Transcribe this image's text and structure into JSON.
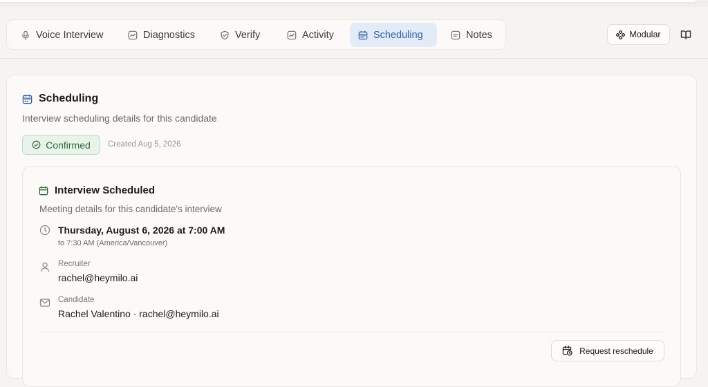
{
  "tabs": [
    {
      "label": "Voice Interview",
      "icon": "microphone-icon"
    },
    {
      "label": "Diagnostics",
      "icon": "chart-line-icon"
    },
    {
      "label": "Verify",
      "icon": "shield-check-icon"
    },
    {
      "label": "Activity",
      "icon": "activity-chart-icon"
    },
    {
      "label": "Scheduling",
      "icon": "calendar-icon",
      "active": true
    },
    {
      "label": "Notes",
      "icon": "notes-icon"
    }
  ],
  "toolbar": {
    "modular_label": "Modular"
  },
  "scheduling": {
    "title": "Scheduling",
    "subtitle": "Interview scheduling details for this candidate",
    "status": "Confirmed",
    "created": "Created Aug 5, 2026",
    "interview": {
      "title": "Interview Scheduled",
      "subtitle": "Meeting details for this candidate's interview",
      "datetime": "Thursday, August 6, 2026 at 7:00 AM",
      "end_time": "to 7:30 AM (America/Vancouver)",
      "recruiter_label": "Recruiter",
      "recruiter_email": "rachel@heymilo.ai",
      "candidate_label": "Candidate",
      "candidate_value": "Rachel Valentino · rachel@heymilo.ai",
      "reschedule_label": "Request reschedule"
    }
  },
  "colors": {
    "accent": "#2f5fae",
    "active_tab_bg": "#e3ebf7",
    "success": "#2d6a39",
    "success_bg": "#e8f4ea"
  }
}
